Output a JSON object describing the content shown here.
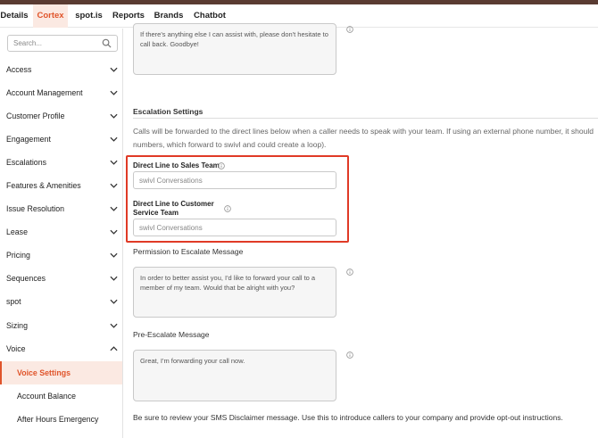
{
  "nav": {
    "items": [
      "Details",
      "Cortex",
      "spot.is",
      "Reports",
      "Brands",
      "Chatbot"
    ],
    "active": "Cortex"
  },
  "sidebar": {
    "search_placeholder": "Search...",
    "items": [
      {
        "label": "Access"
      },
      {
        "label": "Account Management"
      },
      {
        "label": "Customer Profile"
      },
      {
        "label": "Engagement"
      },
      {
        "label": "Escalations"
      },
      {
        "label": "Features & Amenities"
      },
      {
        "label": "Issue Resolution"
      },
      {
        "label": "Lease"
      },
      {
        "label": "Pricing"
      },
      {
        "label": "Sequences"
      },
      {
        "label": "spot"
      },
      {
        "label": "Sizing"
      },
      {
        "label": "Voice"
      }
    ],
    "subitems": [
      {
        "label": "Voice Settings"
      },
      {
        "label": "Account Balance"
      },
      {
        "label": "After Hours Emergency"
      }
    ]
  },
  "main": {
    "goodbye_text": "If there's anything else I can assist with, please don't hesitate to call back. Goodbye!",
    "escalation": {
      "title": "Escalation Settings",
      "help_line1": "Calls will be forwarded to the direct lines below when a caller needs to speak with your team. If using an external phone number, it should",
      "help_line2": "numbers, which forward to swivl and could create a loop).",
      "sales_label": "Direct Line to Sales Team",
      "sales_placeholder": "swivl Conversations",
      "cs_label_line1": "Direct Line to Customer",
      "cs_label_line2": "Service Team",
      "cs_placeholder": "swivl Conversations"
    },
    "permission": {
      "label": "Permission to Escalate Message",
      "text": "In order to better assist you, I'd like to forward your call to a member of my team. Would that be alright with you?"
    },
    "pre_escalate": {
      "label": "Pre-Escalate Message",
      "text": "Great, I'm forwarding your call now."
    },
    "footnote": "Be sure to review your SMS Disclaimer message. Use this to introduce callers to your company and provide opt-out instructions."
  },
  "colors": {
    "accent": "#e0542a",
    "accent_bg": "#fbe9e2",
    "highlight": "#e03a26",
    "topbar": "#5a3b32"
  }
}
